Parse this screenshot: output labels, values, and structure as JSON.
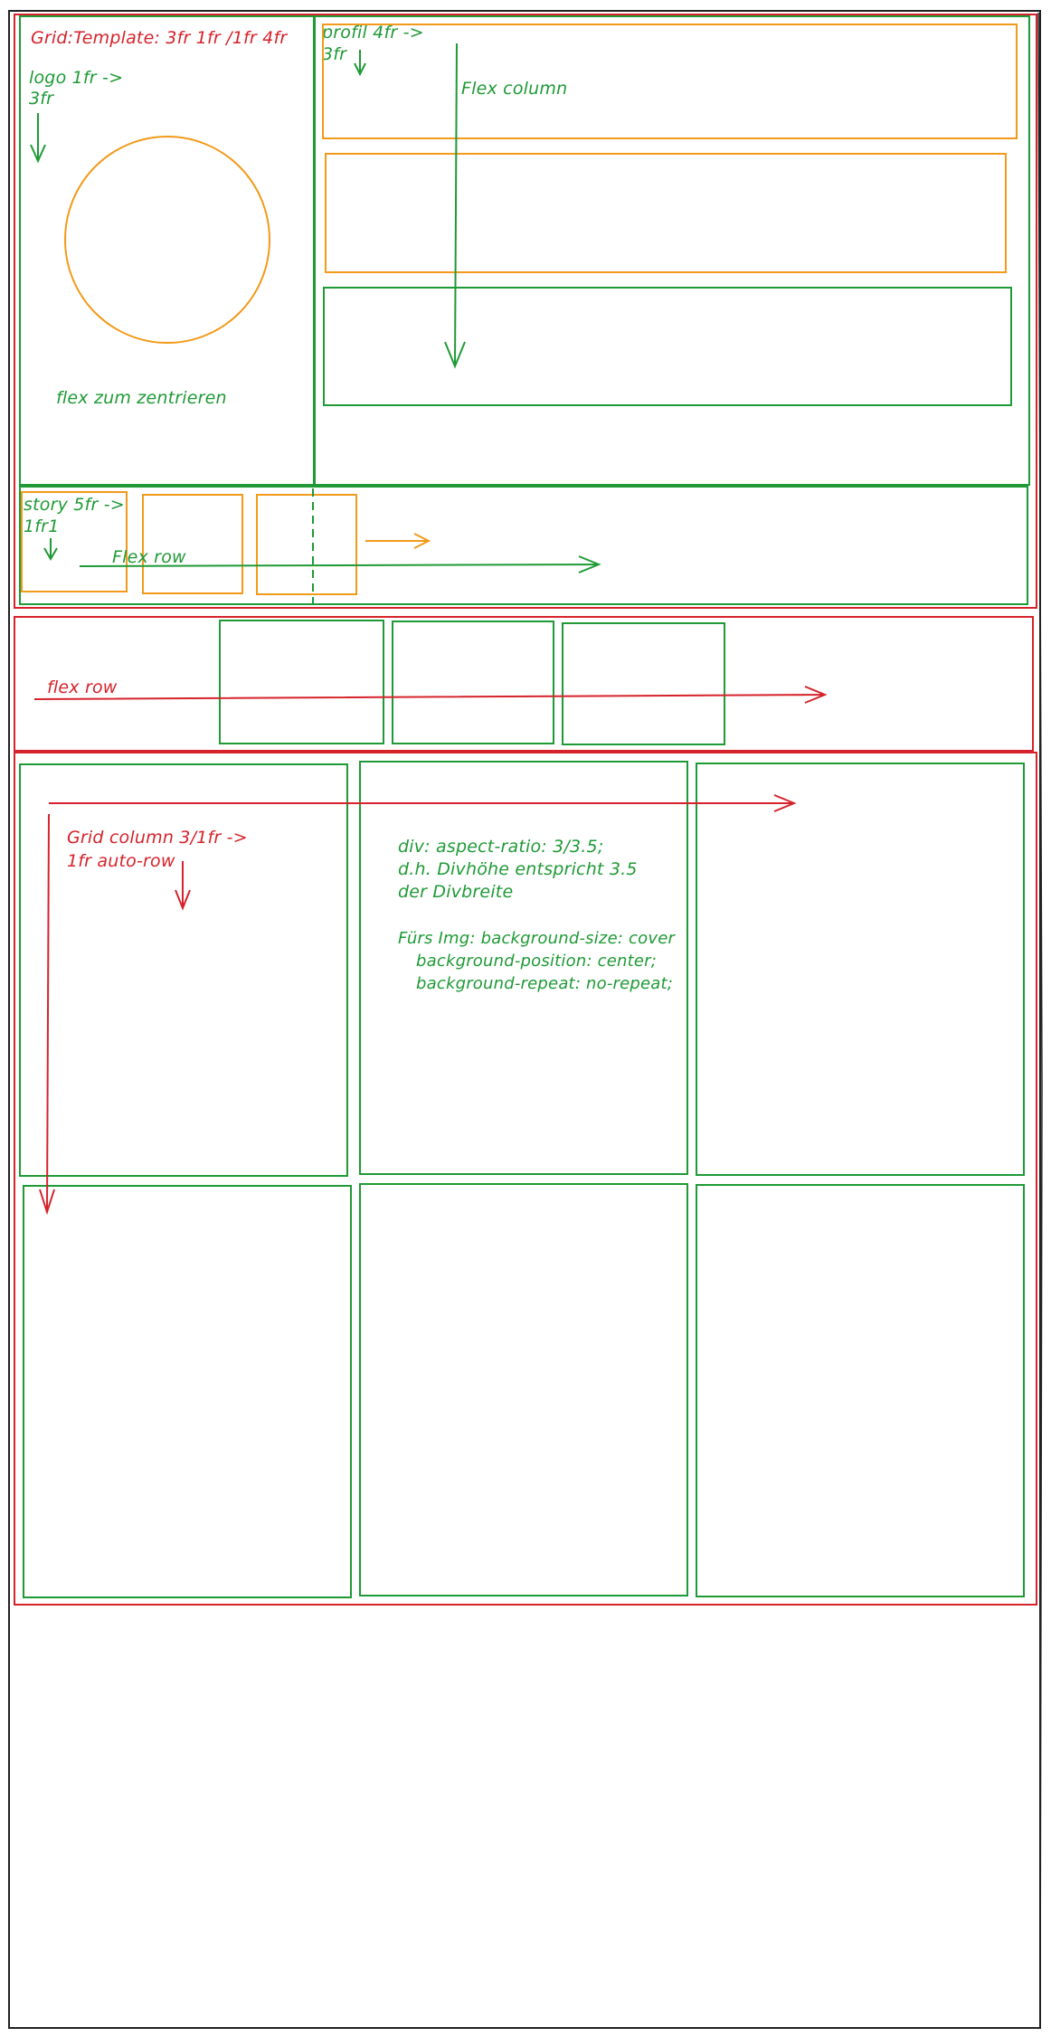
{
  "colors": {
    "red": "#d6232b",
    "green": "#1f9a36",
    "orange": "#f29a1a",
    "black": "#222222"
  },
  "notes": {
    "grid_template": "Grid:Template: 3fr 1fr /1fr 4fr",
    "logo_line1": "logo 1fr ->",
    "logo_line2": "3fr",
    "flex_center": "flex zum zentrieren",
    "profil_line1": "profil 4fr ->",
    "profil_line2": "3fr",
    "flex_column": "Flex column",
    "story_line1": "story 5fr ->",
    "story_line2": "1fr1",
    "flex_row_story": "Flex row",
    "flex_row_mid": "flex row",
    "grid_column_line1": "Grid column 3/1fr ->",
    "grid_column_line2": "1fr auto-row",
    "aspect_line1": "div: aspect-ratio: 3/3.5;",
    "aspect_line2": "d.h. Divhöhe entspricht 3.5",
    "aspect_line3": "der Divbreite",
    "img_line1": "Fürs Img: background-size: cover",
    "img_line2": "background-position: center;",
    "img_line3": "background-repeat: no-repeat;"
  }
}
